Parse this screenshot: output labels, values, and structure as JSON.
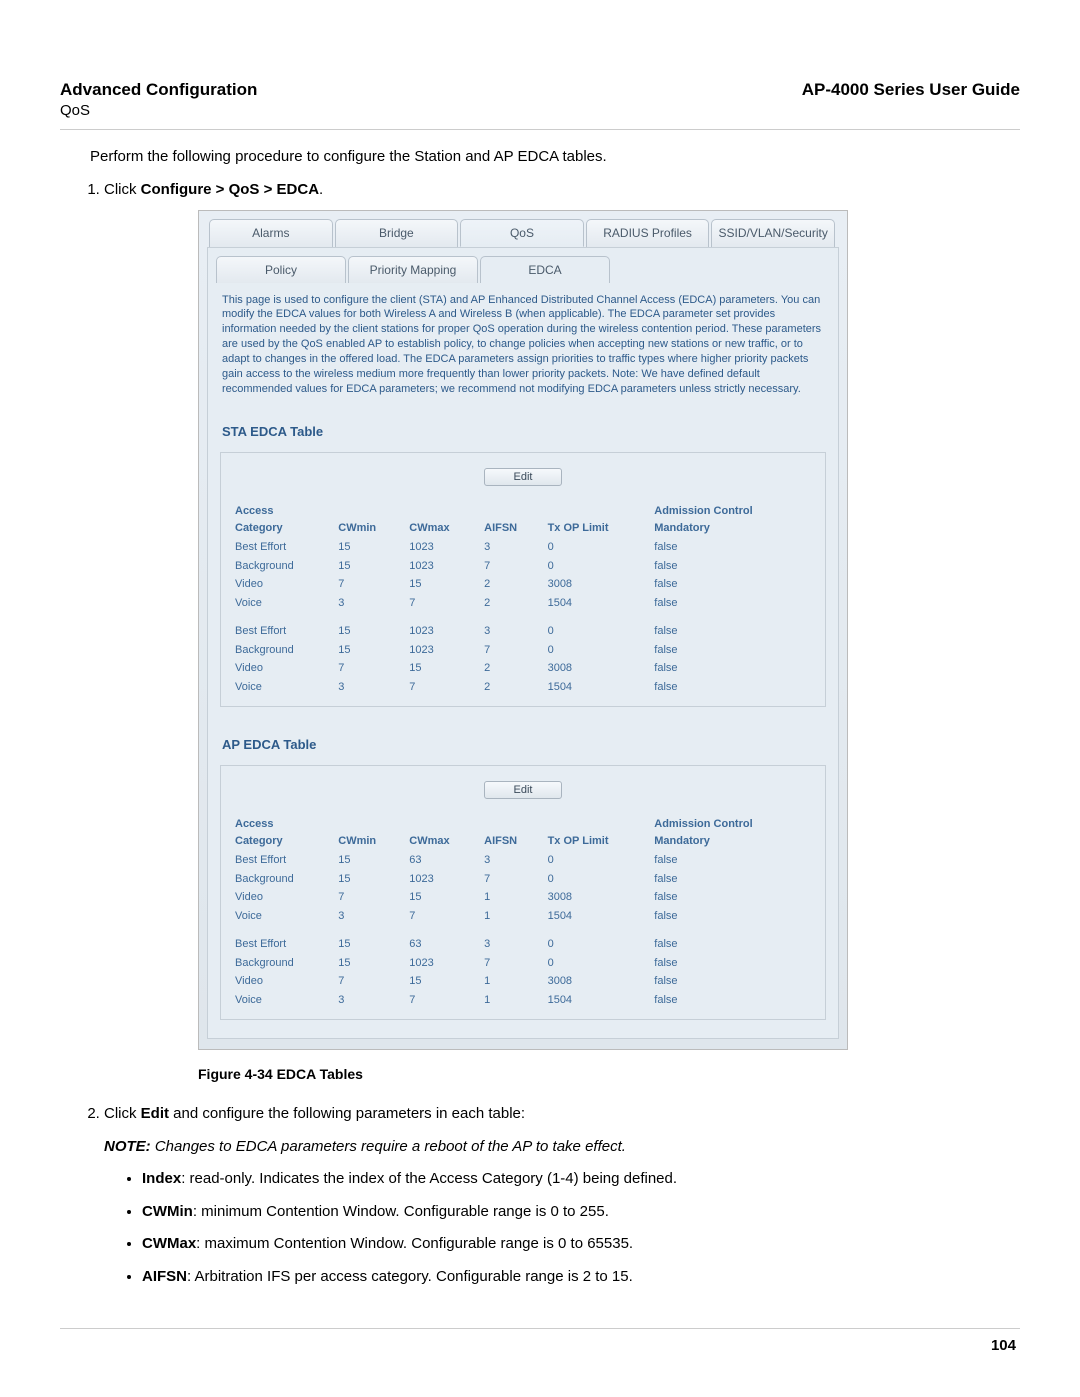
{
  "header": {
    "left_title": "Advanced Configuration",
    "left_sub": "QoS",
    "right_title": "AP-4000 Series User Guide"
  },
  "intro": "Perform the following procedure to configure the Station and AP EDCA tables.",
  "step1": {
    "prefix": "Click ",
    "bold": "Configure > QoS > EDCA",
    "suffix": "."
  },
  "screenshot": {
    "top_tabs": [
      "Alarms",
      "Bridge",
      "QoS",
      "RADIUS Profiles",
      "SSID/VLAN/Security"
    ],
    "top_active_index": 2,
    "sub_tabs": [
      "Policy",
      "Priority Mapping",
      "EDCA"
    ],
    "sub_active_index": 2,
    "description": "This page is used to configure the client (STA) and AP Enhanced Distributed Channel Access (EDCA) parameters. You can modify the EDCA values for both Wireless A and Wireless B (when applicable). The EDCA parameter set provides information needed by the client stations for proper QoS operation during the wireless contention period. These parameters are used by the QoS enabled AP to establish policy, to change policies when accepting new stations or new traffic, or to adapt to changes in the offered load. The EDCA parameters assign priorities to traffic types where higher priority packets gain access to the wireless medium more frequently than lower priority packets. Note: We have defined default recommended values for EDCA parameters; we recommend not modifying EDCA parameters unless strictly necessary.",
    "sta_title": "STA EDCA Table",
    "ap_title": "AP EDCA Table",
    "edit_label": "Edit",
    "columns": [
      "Access Category",
      "CWmin",
      "CWmax",
      "AIFSN",
      "Tx OP Limit",
      "Admission Control Mandatory"
    ],
    "sta_rows": [
      [
        "Best Effort",
        "15",
        "1023",
        "3",
        "0",
        "false"
      ],
      [
        "Background",
        "15",
        "1023",
        "7",
        "0",
        "false"
      ],
      [
        "Video",
        "7",
        "15",
        "2",
        "3008",
        "false"
      ],
      [
        "Voice",
        "3",
        "7",
        "2",
        "1504",
        "false"
      ],
      [
        "Best Effort",
        "15",
        "1023",
        "3",
        "0",
        "false"
      ],
      [
        "Background",
        "15",
        "1023",
        "7",
        "0",
        "false"
      ],
      [
        "Video",
        "7",
        "15",
        "2",
        "3008",
        "false"
      ],
      [
        "Voice",
        "3",
        "7",
        "2",
        "1504",
        "false"
      ]
    ],
    "ap_rows": [
      [
        "Best Effort",
        "15",
        "63",
        "3",
        "0",
        "false"
      ],
      [
        "Background",
        "15",
        "1023",
        "7",
        "0",
        "false"
      ],
      [
        "Video",
        "7",
        "15",
        "1",
        "3008",
        "false"
      ],
      [
        "Voice",
        "3",
        "7",
        "1",
        "1504",
        "false"
      ],
      [
        "Best Effort",
        "15",
        "63",
        "3",
        "0",
        "false"
      ],
      [
        "Background",
        "15",
        "1023",
        "7",
        "0",
        "false"
      ],
      [
        "Video",
        "7",
        "15",
        "1",
        "3008",
        "false"
      ],
      [
        "Voice",
        "3",
        "7",
        "1",
        "1504",
        "false"
      ]
    ]
  },
  "figure_caption": "Figure 4-34 EDCA Tables",
  "step2": {
    "prefix": "Click ",
    "bold1": "Edit",
    "middle": " and configure the following parameters in each table:",
    "note_label": "NOTE:",
    "note_text": " Changes to EDCA parameters require a reboot of the AP to take effect.",
    "bullets": [
      {
        "term": "Index",
        "desc": ": read-only. Indicates the index of the Access Category (1-4) being defined."
      },
      {
        "term": "CWMin",
        "desc": ": minimum Contention Window. Configurable range is 0 to 255."
      },
      {
        "term": "CWMax",
        "desc": ": maximum Contention Window. Configurable range is 0 to 65535."
      },
      {
        "term": "AIFSN",
        "desc": ": Arbitration IFS per access category. Configurable range is 2 to 15."
      }
    ]
  },
  "page_number": "104"
}
